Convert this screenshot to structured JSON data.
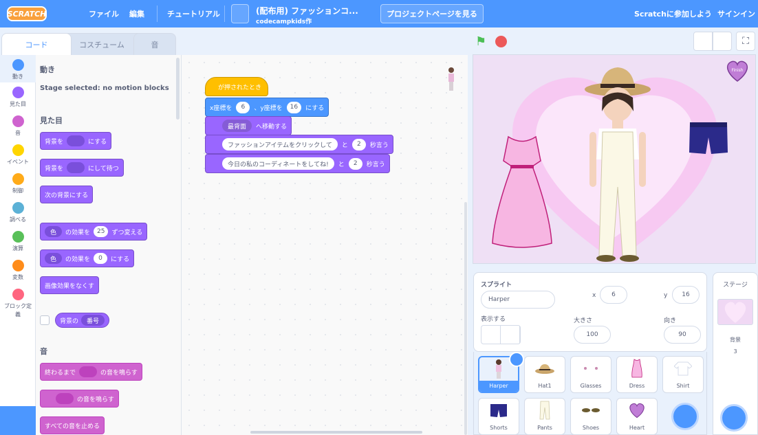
{
  "menubar": {
    "logo": "SCRATCH",
    "file": "ファイル",
    "edit": "編集",
    "tutorial": "チュートリアル",
    "project_title": "(配布用) ファッションコ...",
    "author": "codecampkids作",
    "project_page": "プロジェクトページを見る",
    "join": "Scratchに参加しよう",
    "signin": "サインイン"
  },
  "tabs": [
    "コード",
    "コスチューム",
    "音"
  ],
  "categories": [
    {
      "label": "動き",
      "color": "#4c97ff"
    },
    {
      "label": "見た目",
      "color": "#9966ff"
    },
    {
      "label": "音",
      "color": "#cf63cf"
    },
    {
      "label": "イベント",
      "color": "#ffd500"
    },
    {
      "label": "制御",
      "color": "#ffab19"
    },
    {
      "label": "調べる",
      "color": "#5cb1d6"
    },
    {
      "label": "演算",
      "color": "#59c059"
    },
    {
      "label": "変数",
      "color": "#ff8c1a"
    },
    {
      "label": "ブロック定義",
      "color": "#ff6680"
    }
  ],
  "palette": {
    "motion_title": "動き",
    "motion_note": "Stage selected: no motion blocks",
    "looks_title": "見た目",
    "switch_backdrop_suffix": "にする",
    "switch_backdrop_prefix": "背景を",
    "switch_backdrop_wait_suffix": "にして待つ",
    "next_backdrop": "次の背景にする",
    "change_effect_pill": "色",
    "change_effect_mid": "の効果を",
    "change_effect_val": "25",
    "change_effect_suffix": "ずつ変える",
    "set_effect_pill": "色",
    "set_effect_mid": "の効果を",
    "set_effect_val": "0",
    "set_effect_suffix": "にする",
    "clear_effects": "画像効果をなくす",
    "backdrop_reporter_a": "背景の",
    "backdrop_reporter_b": "番号",
    "sound_title": "音",
    "play_until_done_prefix": "終わるまで",
    "play_until_done_suffix": "の音を鳴らす",
    "start_sound_suffix": "の音を鳴らす",
    "stop_all_sounds": "すべての音を止める"
  },
  "script": {
    "hat": "が押されたとき",
    "goto_x_label": "x座標を",
    "goto_x": "6",
    "goto_y_label": "、y座標を",
    "goto_y": "16",
    "goto_suffix": "にする",
    "layer_pill": "最背面",
    "layer_suffix": "へ移動する",
    "say1_text": "ファッションアイテムをクリックして",
    "say1_mid": "と",
    "say1_secs": "2",
    "say1_suffix": "秒言う",
    "say2_text": "今日の私のコーディネートをしてね!",
    "say2_mid": "と",
    "say2_secs": "2",
    "say2_suffix": "秒言う"
  },
  "stage": {
    "finish_label": "Finish"
  },
  "sprite_info": {
    "sprite_label": "スプライト",
    "sprite_name": "Harper",
    "x_label": "x",
    "x_value": "6",
    "y_label": "y",
    "y_value": "16",
    "show_label": "表示する",
    "size_label": "大きさ",
    "size_value": "100",
    "direction_label": "向き",
    "direction_value": "90"
  },
  "sprites": [
    "Harper",
    "Hat1",
    "Glasses",
    "Dress",
    "Shirt",
    "Shorts",
    "Pants",
    "Shoes",
    "Heart"
  ],
  "stage_panel": {
    "title": "ステージ",
    "backdrops_label": "背景",
    "backdrops_count": "3"
  }
}
